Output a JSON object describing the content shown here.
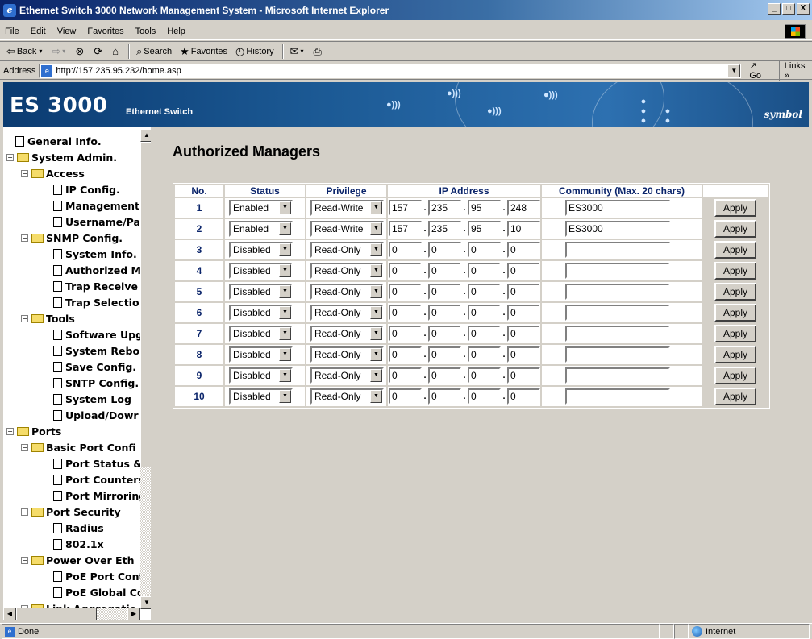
{
  "window": {
    "title": "Ethernet Switch 3000 Network Management System - Microsoft Internet Explorer",
    "min": "_",
    "max": "□",
    "close": "X"
  },
  "menu": [
    "File",
    "Edit",
    "View",
    "Favorites",
    "Tools",
    "Help"
  ],
  "toolbar": {
    "back": "Back",
    "search": "Search",
    "favorites": "Favorites",
    "history": "History"
  },
  "address": {
    "label": "Address",
    "url": "http://157.235.95.232/home.asp",
    "go": "Go",
    "links": "Links"
  },
  "banner": {
    "title": "ES 3000",
    "subtitle": "Ethernet Switch",
    "logo": "symbol"
  },
  "tree": [
    {
      "label": "General Info.",
      "type": "doc"
    },
    {
      "label": "System Admin.",
      "type": "folder"
    },
    {
      "label": "Access",
      "type": "folder"
    },
    {
      "label": "IP Config.",
      "type": "doc"
    },
    {
      "label": "Management",
      "type": "doc"
    },
    {
      "label": "Username/Pa",
      "type": "doc"
    },
    {
      "label": "SNMP Config.",
      "type": "folder"
    },
    {
      "label": "System Info.",
      "type": "doc"
    },
    {
      "label": "Authorized M",
      "type": "doc"
    },
    {
      "label": "Trap Receive",
      "type": "doc"
    },
    {
      "label": "Trap Selectio",
      "type": "doc"
    },
    {
      "label": "Tools",
      "type": "folder"
    },
    {
      "label": "Software Upg",
      "type": "doc"
    },
    {
      "label": "System Rebo",
      "type": "doc"
    },
    {
      "label": "Save Config.",
      "type": "doc"
    },
    {
      "label": "SNTP Config.",
      "type": "doc"
    },
    {
      "label": "System Log",
      "type": "doc"
    },
    {
      "label": "Upload/Dowr",
      "type": "doc"
    },
    {
      "label": "Ports",
      "type": "folder"
    },
    {
      "label": "Basic Port Confi",
      "type": "folder"
    },
    {
      "label": "Port Status &",
      "type": "doc"
    },
    {
      "label": "Port Counters",
      "type": "doc"
    },
    {
      "label": "Port Mirroring",
      "type": "doc"
    },
    {
      "label": "Port Security",
      "type": "folder"
    },
    {
      "label": "Radius",
      "type": "doc"
    },
    {
      "label": "802.1x",
      "type": "doc"
    },
    {
      "label": "Power Over Eth",
      "type": "folder"
    },
    {
      "label": "PoE Port Cont",
      "type": "doc"
    },
    {
      "label": "PoE Global Cc",
      "type": "doc"
    },
    {
      "label": "Link Aggregatio",
      "type": "folder"
    }
  ],
  "page": {
    "title": "Authorized Managers",
    "headers": [
      "No.",
      "Status",
      "Privilege",
      "IP Address",
      "Community (Max. 20 chars)"
    ],
    "apply_label": "Apply",
    "rows": [
      {
        "no": "1",
        "status": "Enabled",
        "privilege": "Read-Write",
        "ip": [
          "157",
          "235",
          "95",
          "248"
        ],
        "community": "ES3000"
      },
      {
        "no": "2",
        "status": "Enabled",
        "privilege": "Read-Write",
        "ip": [
          "157",
          "235",
          "95",
          "10"
        ],
        "community": "ES3000"
      },
      {
        "no": "3",
        "status": "Disabled",
        "privilege": "Read-Only",
        "ip": [
          "0",
          "0",
          "0",
          "0"
        ],
        "community": ""
      },
      {
        "no": "4",
        "status": "Disabled",
        "privilege": "Read-Only",
        "ip": [
          "0",
          "0",
          "0",
          "0"
        ],
        "community": ""
      },
      {
        "no": "5",
        "status": "Disabled",
        "privilege": "Read-Only",
        "ip": [
          "0",
          "0",
          "0",
          "0"
        ],
        "community": ""
      },
      {
        "no": "6",
        "status": "Disabled",
        "privilege": "Read-Only",
        "ip": [
          "0",
          "0",
          "0",
          "0"
        ],
        "community": ""
      },
      {
        "no": "7",
        "status": "Disabled",
        "privilege": "Read-Only",
        "ip": [
          "0",
          "0",
          "0",
          "0"
        ],
        "community": ""
      },
      {
        "no": "8",
        "status": "Disabled",
        "privilege": "Read-Only",
        "ip": [
          "0",
          "0",
          "0",
          "0"
        ],
        "community": ""
      },
      {
        "no": "9",
        "status": "Disabled",
        "privilege": "Read-Only",
        "ip": [
          "0",
          "0",
          "0",
          "0"
        ],
        "community": ""
      },
      {
        "no": "10",
        "status": "Disabled",
        "privilege": "Read-Only",
        "ip": [
          "0",
          "0",
          "0",
          "0"
        ],
        "community": ""
      }
    ]
  },
  "status": {
    "text": "Done",
    "zone": "Internet"
  }
}
